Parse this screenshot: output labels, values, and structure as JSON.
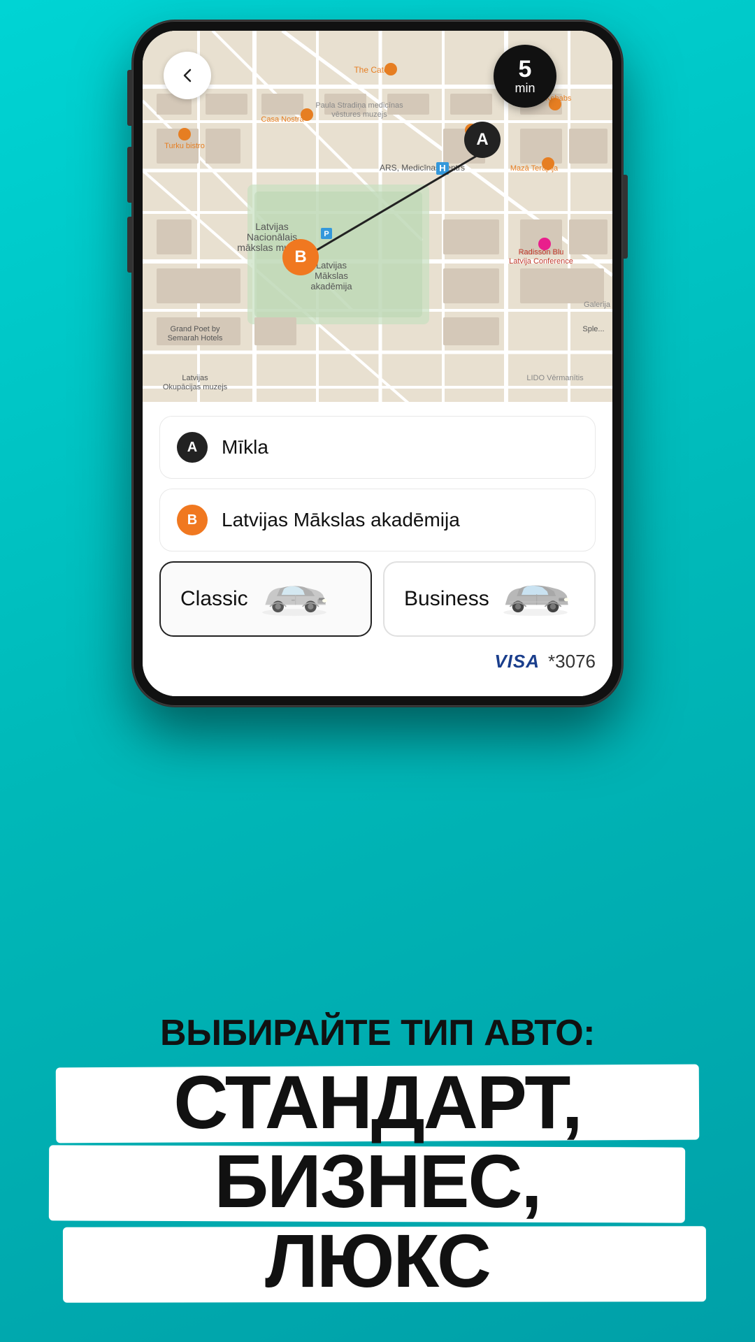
{
  "background": {
    "color": "#00C8C8"
  },
  "phone": {
    "map": {
      "eta": {
        "value": "5",
        "unit": "min"
      },
      "markerA": "A",
      "markerB": "B"
    },
    "locations": {
      "from": {
        "label": "A",
        "text": "Mīkla"
      },
      "to": {
        "label": "B",
        "text": "Latvijas Mākslas akadēmija"
      }
    },
    "carTypes": [
      {
        "id": "classic",
        "label": "Classic",
        "active": true
      },
      {
        "id": "business",
        "label": "Business",
        "active": false
      }
    ],
    "payment": {
      "brand": "VISA",
      "last4": "*3076"
    }
  },
  "promo": {
    "subtitle": "ВЫБИРАЙТЕ ТИП АВТО:",
    "line1": "СТАНДАРТ,",
    "line2": "БИЗНЕС,",
    "line3": "ЛЮКС"
  },
  "back_button": "←"
}
